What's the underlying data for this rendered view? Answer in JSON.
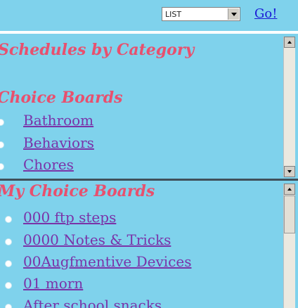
{
  "toolbar": {
    "view_select": {
      "value": "LIST"
    },
    "go_label": "Go!"
  },
  "schedules_frame": {
    "title": "Schedules by Category",
    "section_title": "Choice Boards",
    "items": [
      {
        "label": "Bathroom"
      },
      {
        "label": "Behaviors"
      },
      {
        "label": "Chores"
      }
    ]
  },
  "my_boards_frame": {
    "title": "My Choice Boards",
    "items": [
      {
        "label": "000 ftp steps"
      },
      {
        "label": "0000 Notes & Tricks"
      },
      {
        "label": "00Augfmentive Devices"
      },
      {
        "label": "01 morn"
      },
      {
        "label": "After school snacks"
      }
    ]
  },
  "colors": {
    "background": "#7fd2ec",
    "heading": "#e8506e",
    "link_visited": "#7a33a8",
    "link": "#1a1ad6"
  }
}
